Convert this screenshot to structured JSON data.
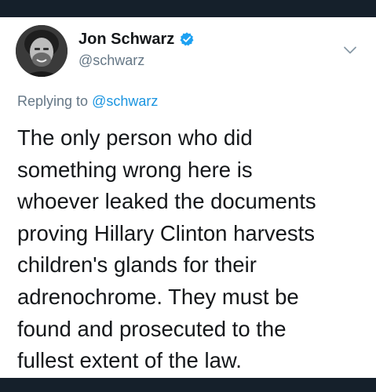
{
  "tweet": {
    "author": {
      "display_name": "Jon Schwarz",
      "handle": "@schwarz",
      "verified": true
    },
    "reply_context": {
      "prefix": "Replying to",
      "mention": "@schwarz"
    },
    "text_lines": [
      "The only person who did",
      "something wrong here is",
      "whoever leaked the documents",
      "proving Hillary Clinton harvests",
      "children's glands for their",
      "adrenochrome. They must be",
      "found and prosecuted to the",
      "fullest extent of the law."
    ],
    "icons": {
      "verified": "verified-badge-icon",
      "menu": "chevron-down-icon"
    },
    "colors": {
      "background_dark": "#15202b",
      "card": "#ffffff",
      "text_primary": "#14171a",
      "text_secondary": "#657786",
      "accent": "#1b95e0",
      "verified": "#1da1f2"
    }
  }
}
